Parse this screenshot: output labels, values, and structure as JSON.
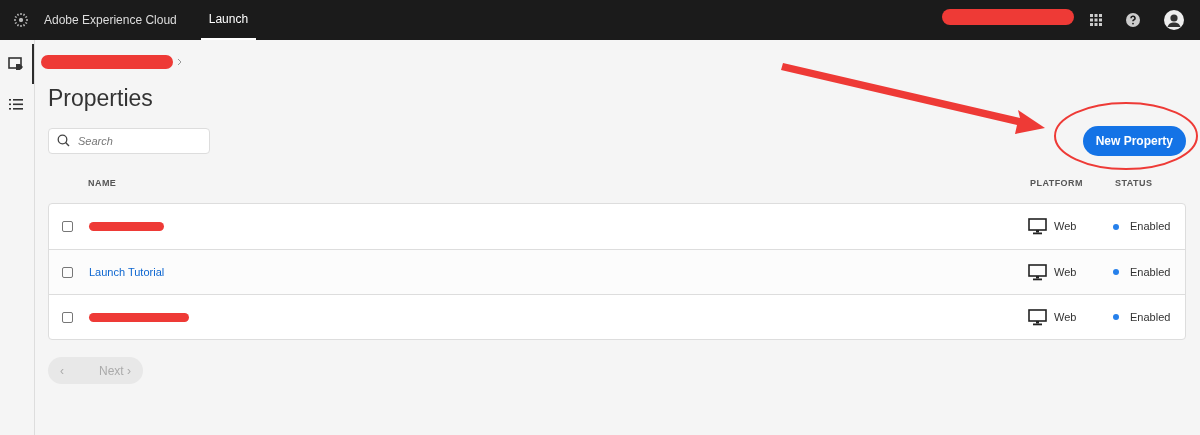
{
  "header": {
    "brand": "Adobe Experience Cloud",
    "nav": [
      {
        "label": "Launch",
        "selected": true
      }
    ],
    "account_redacted": true
  },
  "sidebar": {
    "items": [
      {
        "kind": "properties",
        "selected": true
      },
      {
        "kind": "list",
        "selected": false
      }
    ]
  },
  "breadcrumb": {
    "redacted": true
  },
  "title": "Properties",
  "search": {
    "placeholder": "Search"
  },
  "new_button": "New Property",
  "table": {
    "columns": [
      "NAME",
      "PLATFORM",
      "STATUS"
    ],
    "rows": [
      {
        "name": null,
        "redacted": true,
        "checked": false,
        "platform": "Web",
        "status": "Enabled",
        "color": "#2680eb"
      },
      {
        "name": "Launch Tutorial",
        "redacted": false,
        "checked": false,
        "platform": "Web",
        "status": "Enabled",
        "color": "#2680eb"
      },
      {
        "name": null,
        "redacted": true,
        "checked": false,
        "platform": "Web",
        "status": "Enabled",
        "color": "#2680eb"
      }
    ]
  },
  "pagination": {
    "prev_icon": "‹",
    "next": "Next",
    "next_icon": "›",
    "disabled": true
  },
  "annotation": {
    "arrow": true,
    "circle": true
  }
}
